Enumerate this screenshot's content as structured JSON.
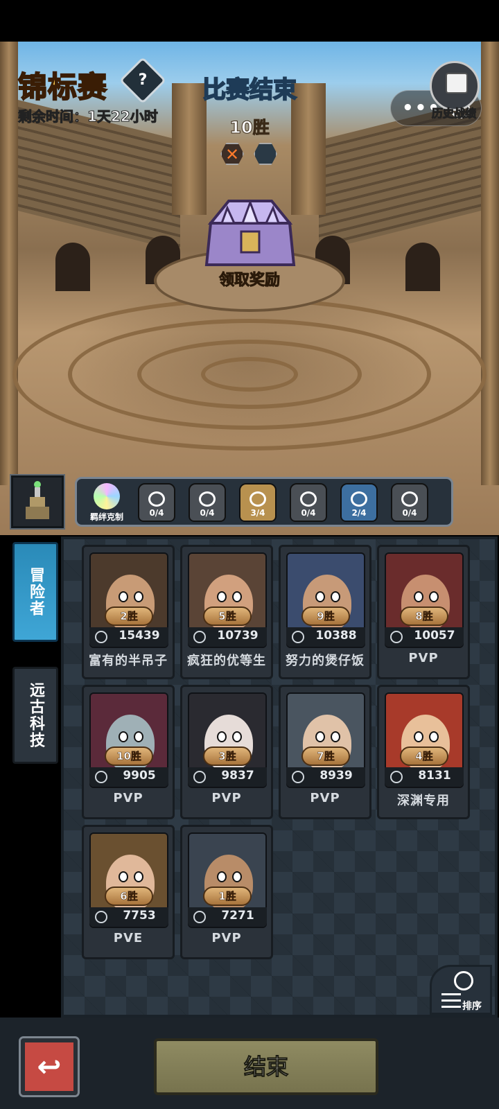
{
  "header": {
    "title": "锦标赛",
    "help": "?",
    "time_remaining": "剩余时间：1天22小时",
    "status": "比赛结束",
    "wins": "10胜",
    "claim_reward": "领取奖励",
    "history_label": "历史战绩",
    "miniapp_menu": "•••"
  },
  "synergy": {
    "label": "羁绊克制",
    "items": [
      {
        "icon": "diamond-icon",
        "count": "0/4",
        "color": "#4a4f55"
      },
      {
        "icon": "eye-icon",
        "count": "0/4",
        "color": "#4a4f55"
      },
      {
        "icon": "crown-icon",
        "count": "3/4",
        "color": "#b8914f"
      },
      {
        "icon": "horseshoe-icon",
        "count": "0/4",
        "color": "#4a4f55"
      },
      {
        "icon": "swirl-icon",
        "count": "2/4",
        "color": "#3d6fa0"
      },
      {
        "icon": "bowtie-icon",
        "count": "0/4",
        "color": "#4a4f55"
      }
    ]
  },
  "tabs": [
    {
      "label": "冒险者",
      "active": true
    },
    {
      "label": "远古科技",
      "active": false
    }
  ],
  "roster": [
    {
      "wins": "2胜",
      "power": "15439",
      "name": "富有的半吊子",
      "bg": "#4c3a2c",
      "skin": "#c89b76",
      "class_icon": "swords-icon"
    },
    {
      "wins": "5胜",
      "power": "10739",
      "name": "疯狂的优等生",
      "bg": "#5a4436",
      "skin": "#d1a07e",
      "class_icon": "swords-icon"
    },
    {
      "wins": "9胜",
      "power": "10388",
      "name": "努力的煲仔饭",
      "bg": "#3b4c6e",
      "skin": "#c79a78",
      "class_icon": "swords-icon"
    },
    {
      "wins": "8胜",
      "power": "10057",
      "name": "PVP",
      "bg": "#6a2c2c",
      "skin": "#c78f70",
      "class_icon": "staff-icon"
    },
    {
      "wins": "10胜",
      "power": "9905",
      "name": "PVP",
      "bg": "#5b2a3a",
      "skin": "#9fb0b6",
      "class_icon": "swords-icon"
    },
    {
      "wins": "3胜",
      "power": "9837",
      "name": "PVP",
      "bg": "#2a2a30",
      "skin": "#e6dcd8",
      "class_icon": "staff-icon"
    },
    {
      "wins": "7胜",
      "power": "8939",
      "name": "PVP",
      "bg": "#4a5560",
      "skin": "#e0c2a8",
      "class_icon": "swords-icon"
    },
    {
      "wins": "4胜",
      "power": "8131",
      "name": "深渊专用",
      "bg": "#a83a2a",
      "skin": "#e8c09a",
      "class_icon": "swords-icon"
    },
    {
      "wins": "6胜",
      "power": "7753",
      "name": "PVE",
      "bg": "#6a5030",
      "skin": "#e0b89a",
      "class_icon": "leaf-icon"
    },
    {
      "wins": "1胜",
      "power": "7271",
      "name": "PVP",
      "bg": "#3a4450",
      "skin": "#b88c68",
      "class_icon": "staff-icon"
    }
  ],
  "sort_label": "排序",
  "footer": {
    "back": "↩",
    "end": "结束"
  }
}
